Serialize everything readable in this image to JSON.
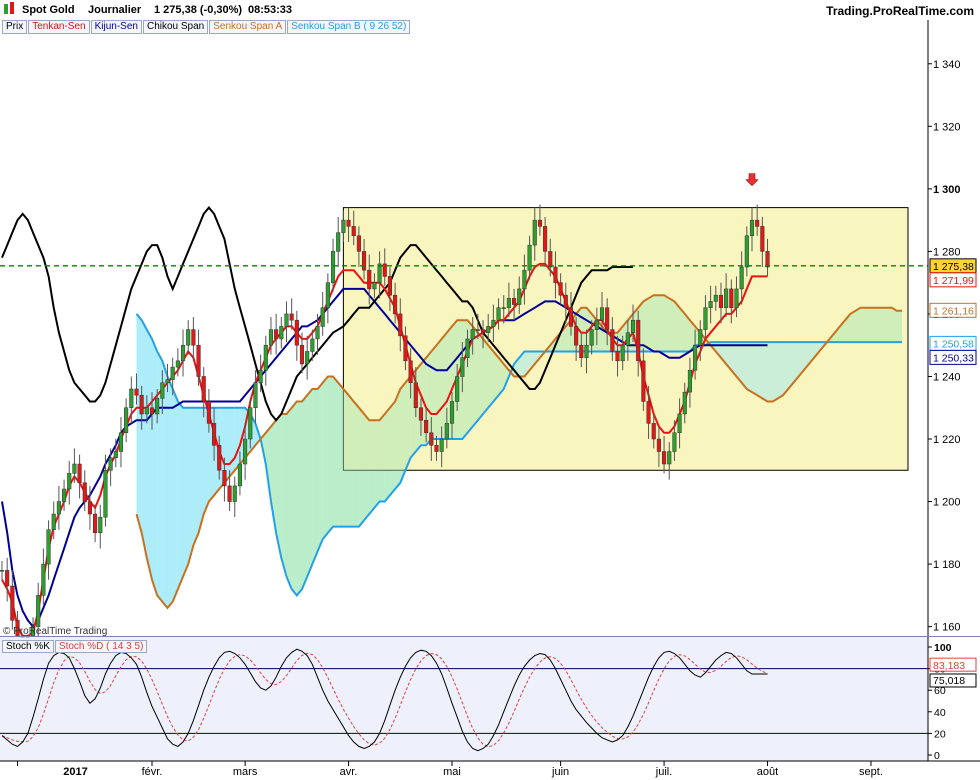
{
  "header": {
    "instrument": "Spot Gold",
    "period": "Journalier",
    "price_change": "1 275,38 (-0,30%)",
    "time": "08:53:33",
    "site": "Trading.ProRealTime.com"
  },
  "legend": {
    "prix": "Prix",
    "tenkan": "Tenkan-Sen",
    "kijun": "Kijun-Sen",
    "chikou": "Chikou Span",
    "senkou_a": "Senkou Span A",
    "senkou_b": "Senkou Span B",
    "senkou_b_params": "( 9 26 52)"
  },
  "colors": {
    "tenkan": "#ee1111",
    "kijun": "#000099",
    "chikou": "#000000",
    "senkou_a": "#c8701e",
    "senkou_b": "#22a0e8",
    "cloud_bull": "#c9f0d9",
    "cloud_bear": "#b8f0fb",
    "range_box": "#f8f3b4",
    "candle_up": "#2e9e2e",
    "candle_down": "#e01818",
    "price_line": "#008800",
    "stoch_bg": "#ecf0fb"
  },
  "watermark": "© ProRealTime Trading",
  "stoch": {
    "label_k": "Stoch %K",
    "label_d": "Stoch %D",
    "params": "( 14 3 5)",
    "ticks": [
      "100",
      "80",
      "60",
      "40",
      "20",
      "0"
    ],
    "value_d": "83,183",
    "value_k": "75,018"
  },
  "chart_data": {
    "type": "candlestick",
    "y_ticks": [
      "1 340",
      "1 320",
      "1 300",
      "1 280",
      "1 260",
      "1 240",
      "1 220",
      "1 200",
      "1 180",
      "1 160"
    ],
    "ylim": [
      1157,
      1354
    ],
    "x_ticks": [
      "2017",
      "févr.",
      "mars",
      "avr.",
      "mai",
      "juin",
      "juil.",
      "août",
      "sept."
    ],
    "price_labels": {
      "last": "1 275,38",
      "tenkan": "1 271,99",
      "senkou_a": "1 261,16",
      "senkou_b": "1 250,58",
      "kijun": "1 250,33"
    },
    "range_box": {
      "high": 1294,
      "low": 1210
    },
    "price": [
      1178,
      1173,
      1162,
      1150,
      1145,
      1152,
      1160,
      1170,
      1180,
      1191,
      1196,
      1200,
      1204,
      1209,
      1212,
      1206,
      1200,
      1196,
      1190,
      1195,
      1210,
      1214,
      1216,
      1222,
      1230,
      1236,
      1234,
      1228,
      1230,
      1228,
      1233,
      1238,
      1239,
      1243,
      1245,
      1250,
      1255,
      1250,
      1240,
      1232,
      1225,
      1218,
      1210,
      1205,
      1200,
      1205,
      1212,
      1220,
      1230,
      1238,
      1242,
      1250,
      1255,
      1252,
      1256,
      1260,
      1258,
      1250,
      1244,
      1248,
      1252,
      1256,
      1262,
      1270,
      1280,
      1286,
      1290,
      1288,
      1285,
      1280,
      1274,
      1268,
      1270,
      1276,
      1272,
      1266,
      1260,
      1253,
      1245,
      1238,
      1230,
      1226,
      1222,
      1218,
      1216,
      1220,
      1225,
      1232,
      1240,
      1246,
      1252,
      1255,
      1255,
      1254,
      1256,
      1258,
      1262,
      1262,
      1265,
      1263,
      1268,
      1274,
      1282,
      1290,
      1288,
      1280,
      1275,
      1270,
      1266,
      1262,
      1256,
      1250,
      1246,
      1250,
      1255,
      1258,
      1262,
      1255,
      1248,
      1245,
      1250,
      1254,
      1258,
      1245,
      1232,
      1225,
      1220,
      1216,
      1212,
      1216,
      1222,
      1228,
      1235,
      1242,
      1250,
      1255,
      1262,
      1264,
      1266,
      1262,
      1268,
      1262,
      1268,
      1275,
      1285,
      1290,
      1288,
      1280,
      1275
    ],
    "tenkan": [
      1175,
      1172,
      1168,
      1160,
      1156,
      1155,
      1158,
      1165,
      1175,
      1185,
      1192,
      1196,
      1200,
      1205,
      1208,
      1206,
      1203,
      1200,
      1198,
      1202,
      1208,
      1212,
      1215,
      1220,
      1224,
      1228,
      1230,
      1230,
      1230,
      1232,
      1234,
      1236,
      1238,
      1240,
      1242,
      1245,
      1248,
      1246,
      1240,
      1234,
      1228,
      1222,
      1216,
      1212,
      1212,
      1214,
      1218,
      1224,
      1232,
      1238,
      1242,
      1246,
      1250,
      1252,
      1254,
      1256,
      1256,
      1254,
      1252,
      1252,
      1254,
      1256,
      1260,
      1264,
      1268,
      1272,
      1274,
      1274,
      1274,
      1272,
      1270,
      1270,
      1270,
      1270,
      1268,
      1265,
      1262,
      1256,
      1250,
      1244,
      1238,
      1234,
      1230,
      1228,
      1228,
      1230,
      1232,
      1236,
      1240,
      1244,
      1248,
      1252,
      1253,
      1254,
      1255,
      1256,
      1258,
      1258,
      1260,
      1262,
      1264,
      1268,
      1272,
      1275,
      1276,
      1276,
      1274,
      1272,
      1268,
      1264,
      1260,
      1256,
      1254,
      1254,
      1256,
      1258,
      1258,
      1255,
      1252,
      1250,
      1250,
      1252,
      1254,
      1248,
      1240,
      1234,
      1228,
      1224,
      1222,
      1222,
      1224,
      1228,
      1232,
      1238,
      1244,
      1248,
      1252,
      1254,
      1256,
      1258,
      1260,
      1260,
      1262,
      1264,
      1268,
      1272,
      1272,
      1272,
      1272
    ],
    "kijun": [
      1200,
      1190,
      1178,
      1170,
      1165,
      1162,
      1160,
      1162,
      1166,
      1170,
      1175,
      1180,
      1185,
      1190,
      1195,
      1198,
      1200,
      1202,
      1205,
      1208,
      1212,
      1215,
      1218,
      1222,
      1224,
      1225,
      1226,
      1226,
      1226,
      1228,
      1230,
      1230,
      1230,
      1230,
      1231,
      1232,
      1232,
      1232,
      1232,
      1232,
      1232,
      1232,
      1232,
      1232,
      1232,
      1232,
      1232,
      1234,
      1236,
      1238,
      1240,
      1242,
      1244,
      1246,
      1248,
      1250,
      1252,
      1254,
      1256,
      1256,
      1257,
      1258,
      1260,
      1262,
      1264,
      1266,
      1268,
      1268,
      1268,
      1268,
      1268,
      1266,
      1264,
      1262,
      1260,
      1258,
      1256,
      1254,
      1252,
      1250,
      1248,
      1246,
      1244,
      1243,
      1242,
      1242,
      1242,
      1244,
      1246,
      1248,
      1250,
      1252,
      1253,
      1254,
      1255,
      1256,
      1258,
      1258,
      1258,
      1258,
      1259,
      1260,
      1261,
      1262,
      1263,
      1264,
      1264,
      1264,
      1263,
      1262,
      1261,
      1260,
      1259,
      1258,
      1257,
      1256,
      1255,
      1254,
      1253,
      1252,
      1251,
      1250,
      1250,
      1250,
      1250,
      1249,
      1248,
      1248,
      1247,
      1246,
      1246,
      1246,
      1247,
      1248,
      1249,
      1250,
      1250,
      1250,
      1250,
      1250,
      1250,
      1250,
      1250,
      1250,
      1250,
      1250,
      1250,
      1250,
      1250
    ],
    "chikou": [
      1220,
      1218,
      1214,
      1206,
      1198,
      1196,
      1200,
      1208,
      1218,
      1226,
      1232,
      1238,
      1242,
      1246,
      1248,
      1246,
      1242,
      1236,
      1230,
      1234,
      1242,
      1250,
      1256,
      1262,
      1268,
      1274,
      1278,
      1282,
      1286,
      1290,
      1292,
      1290,
      1286,
      1282,
      1278,
      1272,
      1262,
      1254,
      1248,
      1242,
      1238,
      1236,
      1234,
      1232,
      1232,
      1234,
      1238,
      1244,
      1250,
      1256,
      1262,
      1268,
      1272,
      1276,
      1280,
      1282,
      1282,
      1278,
      1272,
      1268,
      1272,
      1276,
      1280,
      1284,
      1288,
      1292,
      1294,
      1292,
      1288,
      1284,
      1276,
      1268,
      1262,
      1256,
      1250,
      1244,
      1238,
      1232,
      1228,
      1226,
      1228,
      1232,
      1236,
      1240,
      1242,
      1244,
      1246,
      1248,
      1250,
      1252,
      1254,
      1255,
      1256,
      1258,
      1260,
      1262,
      1262,
      1262,
      1264,
      1266,
      1268,
      1270,
      1274,
      1278,
      1280,
      1282,
      1282,
      1280,
      1278,
      1276,
      1274,
      1272,
      1270,
      1268,
      1266,
      1264,
      1264,
      1262,
      1258,
      1254,
      1252,
      1250,
      1248,
      1246,
      1244,
      1242,
      1240,
      1238,
      1236,
      1236,
      1238,
      1242,
      1246,
      1250,
      1254,
      1258,
      1262,
      1266,
      1270,
      1272,
      1274,
      1274,
      1274,
      1274,
      1275,
      1275,
      1275,
      1275,
      1275
    ],
    "senkou_a": [
      1196,
      1190,
      1182,
      1175,
      1170,
      1168,
      1166,
      1168,
      1172,
      1176,
      1180,
      1186,
      1190,
      1196,
      1200,
      1202,
      1204,
      1206,
      1208,
      1210,
      1212,
      1214,
      1216,
      1218,
      1220,
      1222,
      1224,
      1226,
      1228,
      1228,
      1230,
      1232,
      1232,
      1234,
      1236,
      1236,
      1238,
      1240,
      1240,
      1238,
      1236,
      1234,
      1232,
      1230,
      1228,
      1226,
      1226,
      1226,
      1228,
      1230,
      1232,
      1236,
      1238,
      1240,
      1242,
      1244,
      1246,
      1248,
      1250,
      1252,
      1254,
      1256,
      1258,
      1258,
      1258,
      1256,
      1254,
      1252,
      1250,
      1248,
      1246,
      1244,
      1242,
      1240,
      1240,
      1240,
      1242,
      1244,
      1246,
      1248,
      1250,
      1252,
      1254,
      1256,
      1258,
      1260,
      1262,
      1262,
      1260,
      1258,
      1256,
      1254,
      1254,
      1254,
      1256,
      1258,
      1260,
      1262,
      1264,
      1265,
      1266,
      1266,
      1266,
      1265,
      1264,
      1262,
      1260,
      1258,
      1256,
      1254,
      1252,
      1250,
      1248,
      1246,
      1244,
      1242,
      1240,
      1238,
      1236,
      1235,
      1234,
      1233,
      1232,
      1232,
      1233,
      1234,
      1236,
      1238,
      1240,
      1242,
      1244,
      1246,
      1248,
      1250,
      1252,
      1254,
      1256,
      1258,
      1260,
      1261,
      1262,
      1262,
      1262,
      1262,
      1262,
      1262,
      1262,
      1261,
      1261
    ],
    "senkou_b": [
      1260,
      1258,
      1255,
      1252,
      1248,
      1245,
      1240,
      1236,
      1232,
      1230,
      1230,
      1230,
      1230,
      1230,
      1230,
      1230,
      1230,
      1230,
      1230,
      1230,
      1230,
      1230,
      1228,
      1225,
      1220,
      1212,
      1200,
      1190,
      1182,
      1176,
      1172,
      1170,
      1172,
      1176,
      1180,
      1184,
      1188,
      1190,
      1192,
      1192,
      1192,
      1192,
      1192,
      1192,
      1194,
      1196,
      1198,
      1200,
      1200,
      1202,
      1204,
      1206,
      1210,
      1214,
      1216,
      1218,
      1218,
      1220,
      1220,
      1220,
      1220,
      1220,
      1220,
      1220,
      1222,
      1224,
      1226,
      1228,
      1230,
      1232,
      1234,
      1236,
      1240,
      1244,
      1246,
      1248,
      1248,
      1248,
      1248,
      1248,
      1248,
      1248,
      1248,
      1248,
      1248,
      1248,
      1248,
      1248,
      1248,
      1248,
      1248,
      1248,
      1248,
      1248,
      1248,
      1248,
      1248,
      1248,
      1248,
      1248,
      1248,
      1248,
      1248,
      1248,
      1248,
      1248,
      1248,
      1248,
      1250,
      1250,
      1250,
      1251,
      1251,
      1251,
      1251,
      1251,
      1251,
      1251,
      1251,
      1251,
      1251,
      1251,
      1251,
      1251,
      1251,
      1251,
      1251,
      1251,
      1251,
      1251,
      1251,
      1251,
      1251,
      1251,
      1251,
      1251,
      1251,
      1251,
      1251,
      1251,
      1251,
      1251,
      1251,
      1251,
      1251,
      1251,
      1251,
      1251,
      1251
    ],
    "stoch_k": [
      18,
      14,
      10,
      8,
      12,
      20,
      35,
      52,
      70,
      85,
      92,
      95,
      94,
      90,
      80,
      68,
      55,
      48,
      52,
      62,
      75,
      85,
      92,
      95,
      94,
      90,
      84,
      72,
      58,
      45,
      35,
      25,
      15,
      10,
      8,
      12,
      20,
      32,
      46,
      60,
      72,
      82,
      90,
      95,
      96,
      94,
      90,
      84,
      76,
      68,
      62,
      60,
      64,
      72,
      82,
      90,
      95,
      98,
      96,
      92,
      84,
      72,
      60,
      50,
      42,
      34,
      26,
      18,
      12,
      8,
      6,
      8,
      12,
      20,
      32,
      46,
      60,
      72,
      82,
      90,
      95,
      97,
      96,
      92,
      85,
      75,
      62,
      48,
      35,
      22,
      12,
      6,
      4,
      6,
      10,
      18,
      28,
      40,
      52,
      64,
      74,
      82,
      88,
      92,
      94,
      93,
      88,
      80,
      70,
      60,
      50,
      42,
      36,
      30,
      25,
      20,
      16,
      14,
      12,
      14,
      18,
      26,
      36,
      48,
      60,
      72,
      82,
      90,
      95,
      96,
      94,
      90,
      84,
      78,
      74,
      72,
      76,
      82,
      88,
      92,
      95,
      94,
      90,
      84,
      78,
      75,
      75,
      75,
      75
    ]
  }
}
